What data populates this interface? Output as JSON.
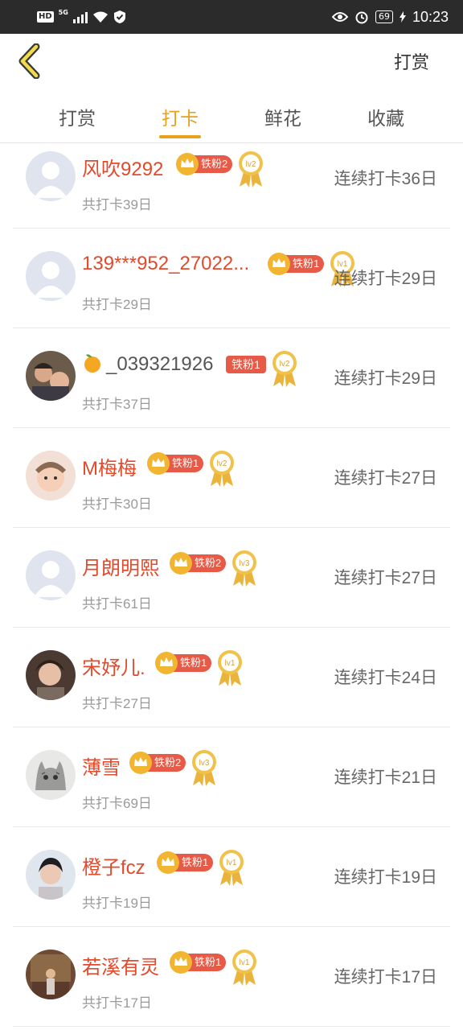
{
  "status_bar": {
    "left": {
      "hd": "HD",
      "network": "5G"
    },
    "battery": "69",
    "time": "10:23"
  },
  "header": {
    "back_icon": "chevron-left-icon",
    "right_action": "打赏"
  },
  "tabs": [
    {
      "label": "打赏",
      "active": false
    },
    {
      "label": "打卡",
      "active": true
    },
    {
      "label": "鲜花",
      "active": false
    },
    {
      "label": "收藏",
      "active": false
    }
  ],
  "colors": {
    "accent": "#e7a21d",
    "name_red": "#e24a2c",
    "badge_red": "#e65a47",
    "gold": "#f1b531"
  },
  "rows": [
    {
      "name": "风吹9292",
      "fan_badge": "铁粉2",
      "medal_level": "lv2",
      "total": "共打卡39日",
      "streak": "连续打卡36日",
      "avatar": "default"
    },
    {
      "name": "139***952_27022...",
      "fan_badge": "铁粉1",
      "medal_level": "lv1",
      "total": "共打卡29日",
      "streak": "连续打卡29日",
      "avatar": "default"
    },
    {
      "name": "_039321926",
      "fan_badge": "铁粉1",
      "medal_level": "lv2",
      "total": "共打卡37日",
      "streak": "连续打卡29日",
      "avatar": "photo"
    },
    {
      "name": "M梅梅",
      "fan_badge": "铁粉1",
      "medal_level": "lv2",
      "total": "共打卡30日",
      "streak": "连续打卡27日",
      "avatar": "photo"
    },
    {
      "name": "月朗明熙",
      "fan_badge": "铁粉2",
      "medal_level": "lv3",
      "total": "共打卡61日",
      "streak": "连续打卡27日",
      "avatar": "default"
    },
    {
      "name": "宋妤儿.",
      "fan_badge": "铁粉1",
      "medal_level": "lv1",
      "total": "共打卡27日",
      "streak": "连续打卡24日",
      "avatar": "photo"
    },
    {
      "name": "薄雪",
      "fan_badge": "铁粉2",
      "medal_level": "lv3",
      "total": "共打卡69日",
      "streak": "连续打卡21日",
      "avatar": "photo"
    },
    {
      "name": "橙子fcz",
      "fan_badge": "铁粉1",
      "medal_level": "lv1",
      "total": "共打卡19日",
      "streak": "连续打卡19日",
      "avatar": "photo"
    },
    {
      "name": "若溪有灵",
      "fan_badge": "铁粉1",
      "medal_level": "lv1",
      "total": "共打卡17日",
      "streak": "连续打卡17日",
      "avatar": "photo"
    }
  ]
}
